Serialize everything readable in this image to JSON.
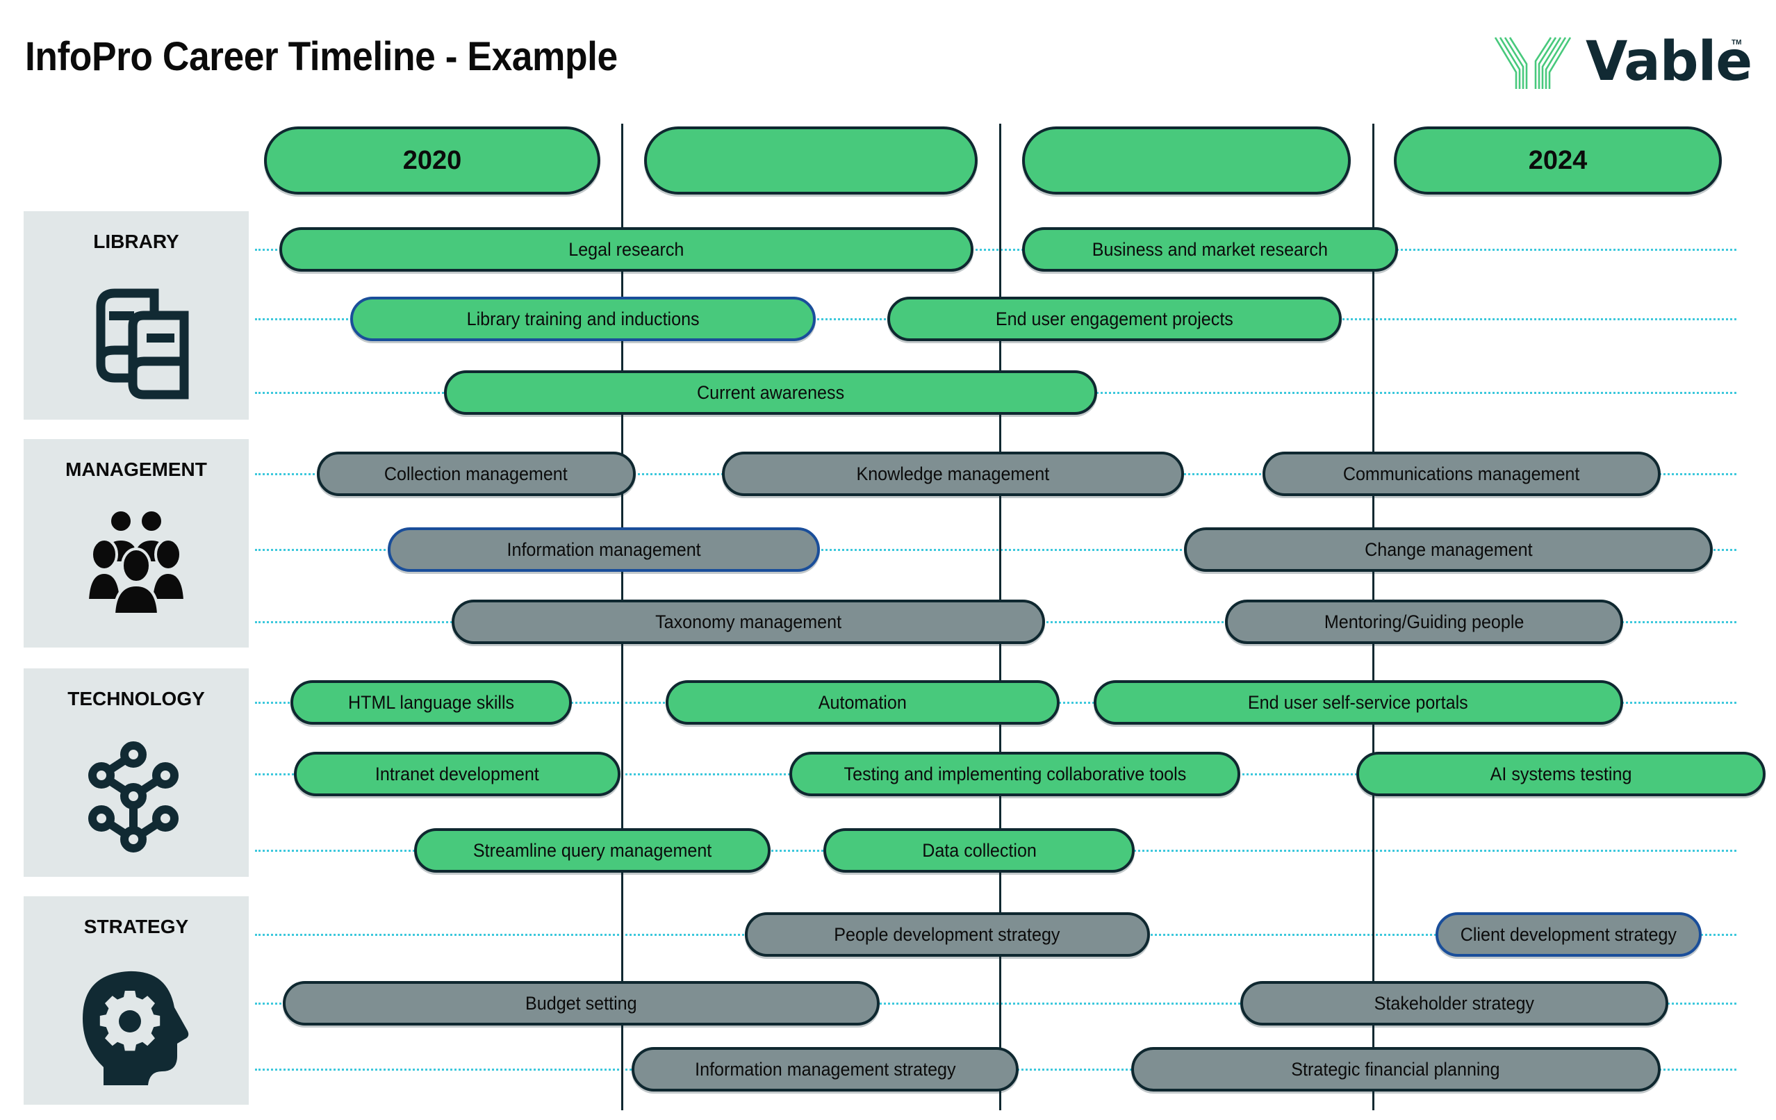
{
  "title": "InfoPro Career Timeline - Example",
  "logo": {
    "text": "Vable",
    "trademark": "TM",
    "icon": "vable-stripes-logo"
  },
  "colors": {
    "skill_green": "#48c97c",
    "skill_gray": "#7f8f92",
    "outline_dark": "#0f2830",
    "outline_highlight_blue": "#1a4e9a",
    "connector_dots": "#3cc8dc",
    "panel_bg": "#e1e7e8"
  },
  "timeline": {
    "columns": [
      {
        "label": "2020"
      },
      {
        "label": ""
      },
      {
        "label": ""
      },
      {
        "label": "2024"
      }
    ]
  },
  "categories": [
    {
      "name": "LIBRARY",
      "icon": "books-icon",
      "color": "green",
      "rows": [
        [
          {
            "label": "Legal research",
            "start": 0.04,
            "end": 1.89,
            "highlight": false
          },
          {
            "label": "Business and market research",
            "start": 2.02,
            "end": 3.02,
            "highlight": false
          }
        ],
        [
          {
            "label": "Library training and inductions",
            "start": 0.23,
            "end": 1.47,
            "highlight": true
          },
          {
            "label": "End user engagement projects",
            "start": 1.66,
            "end": 2.87,
            "highlight": false
          }
        ],
        [
          {
            "label": "Current awareness",
            "start": 0.48,
            "end": 2.22,
            "highlight": false
          }
        ]
      ]
    },
    {
      "name": "MANAGEMENT",
      "icon": "people-group-icon",
      "color": "gray",
      "rows": [
        [
          {
            "label": "Collection management",
            "start": 0.14,
            "end": 0.99,
            "highlight": false
          },
          {
            "label": "Knowledge management",
            "start": 1.22,
            "end": 2.45,
            "highlight": false
          },
          {
            "label": "Communications management",
            "start": 2.66,
            "end": 3.72,
            "highlight": false
          }
        ],
        [
          {
            "label": "Information management",
            "start": 0.33,
            "end": 1.48,
            "highlight": true
          },
          {
            "label": "Change management",
            "start": 2.45,
            "end": 3.86,
            "highlight": false
          }
        ],
        [
          {
            "label": "Taxonomy management",
            "start": 0.5,
            "end": 2.08,
            "highlight": false
          },
          {
            "label": "Mentoring/Guiding people",
            "start": 2.56,
            "end": 3.62,
            "highlight": false
          }
        ]
      ]
    },
    {
      "name": "TECHNOLOGY",
      "icon": "network-nodes-icon",
      "color": "green",
      "rows": [
        [
          {
            "label": "HTML language skills",
            "start": 0.07,
            "end": 0.82,
            "highlight": false
          },
          {
            "label": "Automation",
            "start": 1.07,
            "end": 2.12,
            "highlight": false
          },
          {
            "label": "End user self-service portals",
            "start": 2.21,
            "end": 3.62,
            "highlight": false
          }
        ],
        [
          {
            "label": "Intranet development",
            "start": 0.08,
            "end": 0.95,
            "highlight": false
          },
          {
            "label": "Testing and implementing collaborative tools",
            "start": 1.4,
            "end": 2.6,
            "highlight": false
          },
          {
            "label": "AI systems testing",
            "start": 2.91,
            "end": 4.0,
            "highlight": false
          }
        ],
        [
          {
            "label": "Streamline query management",
            "start": 0.4,
            "end": 1.35,
            "highlight": false
          },
          {
            "label": "Data collection",
            "start": 1.49,
            "end": 2.32,
            "highlight": false
          }
        ]
      ]
    },
    {
      "name": "STRATEGY",
      "icon": "head-gear-icon",
      "color": "gray",
      "rows": [
        [
          {
            "label": "People development strategy",
            "start": 1.28,
            "end": 2.36,
            "highlight": false
          },
          {
            "label": "Client development strategy",
            "start": 3.12,
            "end": 3.83,
            "highlight": true
          }
        ],
        [
          {
            "label": "Budget setting",
            "start": 0.05,
            "end": 1.64,
            "highlight": false
          },
          {
            "label": "Stakeholder strategy",
            "start": 2.6,
            "end": 3.74,
            "highlight": false
          }
        ],
        [
          {
            "label": "Information management strategy",
            "start": 0.98,
            "end": 2.01,
            "highlight": false
          },
          {
            "label": "Strategic financial planning",
            "start": 2.31,
            "end": 3.72,
            "highlight": false
          }
        ]
      ]
    }
  ]
}
